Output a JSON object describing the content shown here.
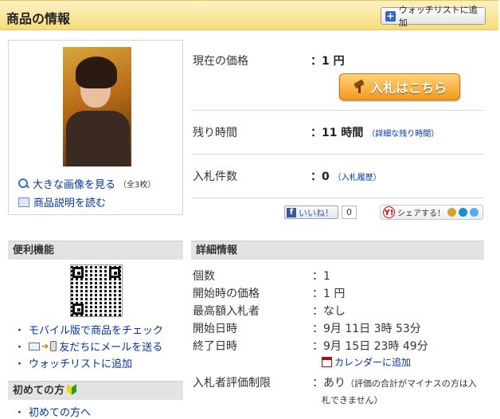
{
  "header": {
    "title": "商品の情報",
    "watchlist_button": "ウォッチリストに追加"
  },
  "image_box": {
    "photo_alt": "出品者の写真",
    "large_image_link": "大きな画像を見る",
    "large_image_count": "（全3枚）",
    "description_link": "商品説明を読む"
  },
  "price": {
    "current_label": "現在の価格",
    "current_value": "：1 円",
    "bid_button": "入札はこちら",
    "remaining_label": "残り時間",
    "remaining_value": "：11 時間",
    "remaining_detail_link": "（詳細な残り時間）",
    "bids_label": "入札件数",
    "bids_value": "：0",
    "bids_history_link": "（入札履歴）"
  },
  "social": {
    "fb_like": "いいね！",
    "fb_count": "0",
    "share_label": "シェアする！",
    "colors": {
      "mixi": "#d9a230",
      "hatena": "#1a8fd6",
      "twitter": "#55acee"
    }
  },
  "convenience": {
    "title": "便利機能",
    "links": [
      "モバイル版で商品をチェック",
      "友だちにメールを送る",
      "ウォッチリストに追加"
    ]
  },
  "beginner": {
    "title": "初めての方",
    "link": "初めての方へ"
  },
  "details": {
    "title": "詳細情報",
    "rows": [
      {
        "label": "個数",
        "value": "：1"
      },
      {
        "label": "開始時の価格",
        "value": "：1 円"
      },
      {
        "label": "最高額入札者",
        "value": "：なし"
      },
      {
        "label": "開始日時",
        "value": "：9月 11日 3時 53分"
      },
      {
        "label": "終了日時",
        "value": "：9月 15日 23時 49分"
      }
    ],
    "calendar_link": "カレンダーに追加",
    "rating_label": "入札者評価制限",
    "rating_value": "：あり",
    "rating_note_line1": "（評価の合計がマイナスの方は入",
    "rating_note_line2": "札できません）"
  }
}
